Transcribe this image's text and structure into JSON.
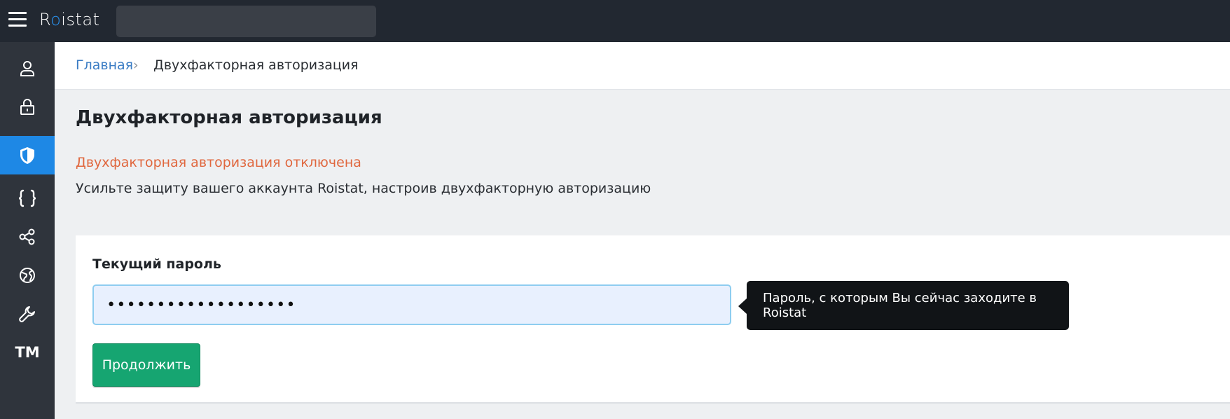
{
  "app": {
    "logo_prefix": "R",
    "logo_dot": "o",
    "logo_suffix": "istat",
    "search_placeholder": ""
  },
  "sidebar": {
    "items": [
      {
        "icon": "user-icon",
        "active": false
      },
      {
        "icon": "lock-icon",
        "active": false
      },
      {
        "icon": "shield-icon",
        "active": true
      },
      {
        "icon": "braces-icon",
        "active": false
      },
      {
        "icon": "share-icon",
        "active": false
      },
      {
        "icon": "globe-icon",
        "active": false
      },
      {
        "icon": "wrench-icon",
        "active": false
      },
      {
        "icon": "tm-icon",
        "label": "TM",
        "active": false
      }
    ]
  },
  "breadcrumb": {
    "home": "Главная",
    "separator": "›",
    "current": "Двухфакторная авторизация"
  },
  "main": {
    "title": "Двухфакторная авторизация",
    "status": "Двухфакторная авторизация отключена",
    "description": "Усильте защиту вашего аккаунта Roistat, настроив двухфакторную авторизацию"
  },
  "form": {
    "password_label": "Текущий пароль",
    "password_value": "•••••••••••••••••••",
    "tooltip": "Пароль, с которым Вы сейчас заходите в Roistat",
    "continue_label": "Продолжить"
  },
  "colors": {
    "topbar": "#222831",
    "sidebar": "#2f343c",
    "active_accent": "#1e88e5",
    "link": "#3a7cc4",
    "status_warning": "#e0673e",
    "button_green": "#16a571"
  }
}
